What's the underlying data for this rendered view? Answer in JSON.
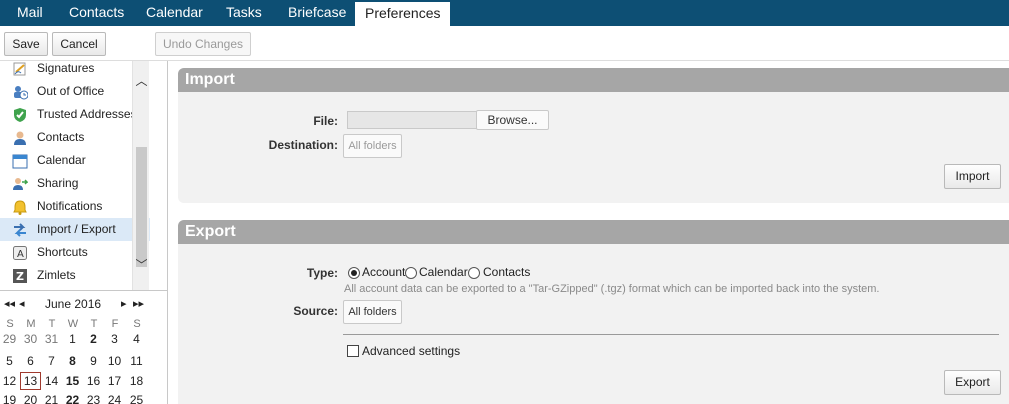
{
  "app_tabs": [
    {
      "label": "Mail"
    },
    {
      "label": "Contacts"
    },
    {
      "label": "Calendar"
    },
    {
      "label": "Tasks"
    },
    {
      "label": "Briefcase"
    },
    {
      "label": "Preferences",
      "active": true
    }
  ],
  "toolbar": {
    "save_label": "Save",
    "cancel_label": "Cancel",
    "undo_label": "Undo Changes"
  },
  "sidebar": {
    "items": [
      {
        "label": "Signatures",
        "icon": "signature-icon"
      },
      {
        "label": "Out of Office",
        "icon": "out-of-office-icon"
      },
      {
        "label": "Trusted Addresses",
        "icon": "shield-check-icon"
      },
      {
        "label": "Contacts",
        "icon": "contact-person-icon"
      },
      {
        "label": "Calendar",
        "icon": "calendar-icon"
      },
      {
        "label": "Sharing",
        "icon": "sharing-icon"
      },
      {
        "label": "Notifications",
        "icon": "bell-icon"
      },
      {
        "label": "Import / Export",
        "icon": "import-export-icon",
        "selected": true
      },
      {
        "label": "Shortcuts",
        "icon": "keyboard-shortcut-icon"
      },
      {
        "label": "Zimlets",
        "icon": "zimlet-icon"
      }
    ]
  },
  "mini_calendar": {
    "month_label": "June 2016",
    "prev_year": "◂◂",
    "prev_month": "◂",
    "next_month": "▸",
    "next_year": "▸▸",
    "weekdays": [
      "S",
      "M",
      "T",
      "W",
      "T",
      "F",
      "S"
    ],
    "weeks": [
      [
        "29",
        "30",
        "31",
        "1",
        "2",
        "3",
        "4"
      ],
      [
        "5",
        "6",
        "7",
        "8",
        "9",
        "10",
        "11"
      ],
      [
        "12",
        "13",
        "14",
        "15",
        "16",
        "17",
        "18"
      ],
      [
        "19",
        "20",
        "21",
        "22",
        "23",
        "24",
        "25"
      ]
    ],
    "today": "13"
  },
  "import": {
    "title": "Import",
    "file_label": "File:",
    "browse_label": "Browse...",
    "destination_label": "Destination:",
    "destination_value": "All folders",
    "import_button": "Import"
  },
  "export": {
    "title": "Export",
    "type_label": "Type:",
    "types": [
      "Account",
      "Calendar",
      "Contacts"
    ],
    "selected_type": "Account",
    "hint": "All account data can be exported to a \"Tar-GZipped\" (.tgz) format which can be imported back into the system.",
    "source_label": "Source:",
    "source_value": "All folders",
    "advanced_label": "Advanced settings",
    "export_button": "Export"
  }
}
